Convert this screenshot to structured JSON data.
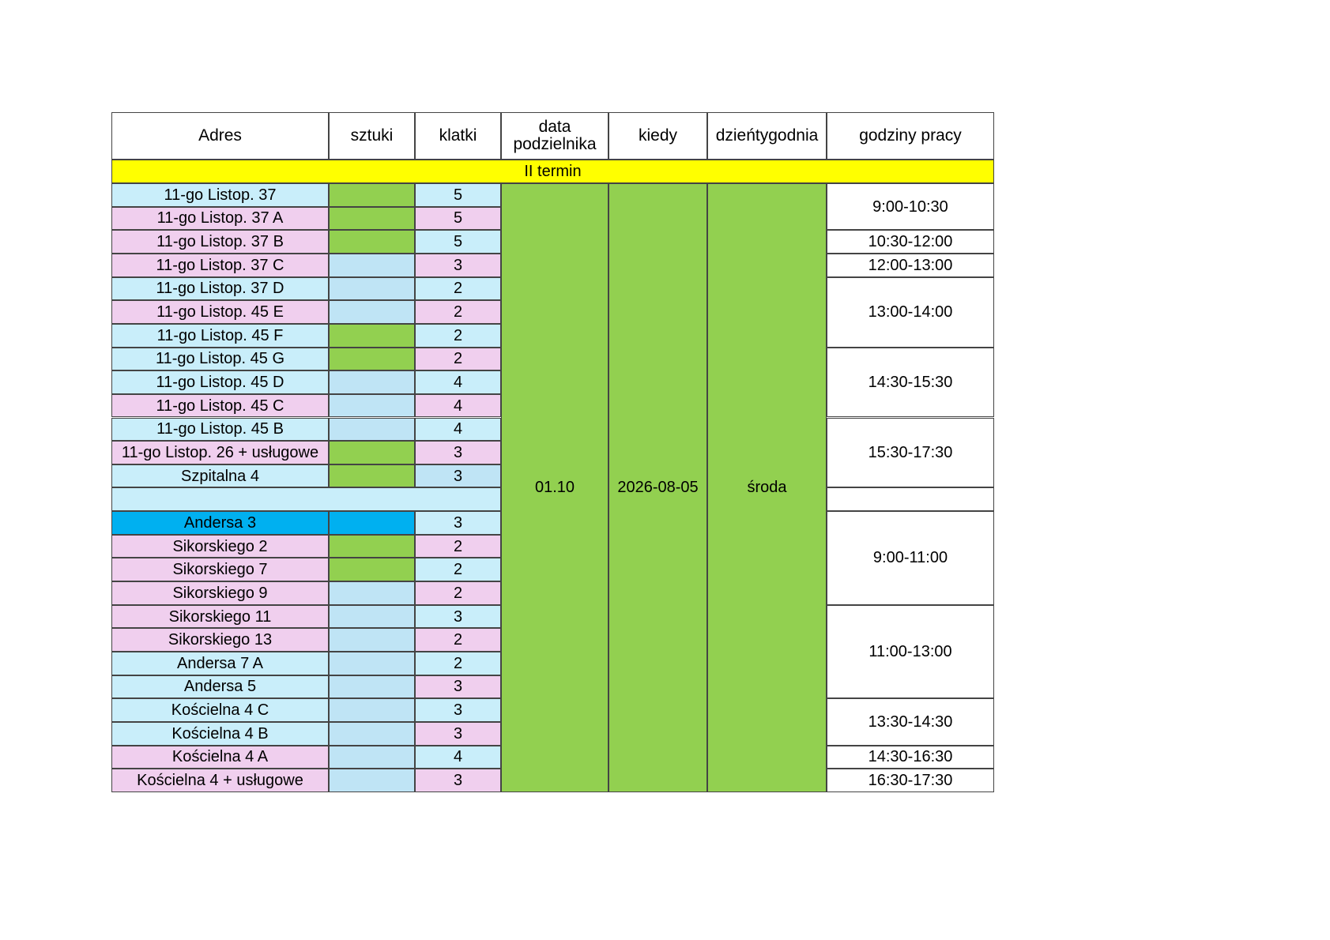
{
  "colors": {
    "header": "#ffffff",
    "section": "#ffff00",
    "light_blue": "#c9eefa",
    "pink": "#f0cfee",
    "green": "#92d050",
    "pale_blue": "#bfe4f5",
    "bright_blue": "#00b0f0",
    "white": "#ffffff"
  },
  "headers": [
    "Adres",
    "sztuki",
    "klatki",
    "data podzielnika",
    "kiedy",
    "dzieńtygodnia",
    "godziny pracy"
  ],
  "section": "II termin",
  "rows": [
    {
      "adres": "11-go Listop. 37",
      "klatki": "5",
      "adres_color": "light_blue",
      "sztuki_color": "green",
      "klatki_color": "light_blue"
    },
    {
      "adres": "11-go Listop. 37 A",
      "klatki": "5",
      "adres_color": "pink",
      "sztuki_color": "green",
      "klatki_color": "pink"
    },
    {
      "adres": "11-go Listop. 37 B",
      "klatki": "5",
      "adres_color": "pink",
      "sztuki_color": "green",
      "klatki_color": "light_blue"
    },
    {
      "adres": "11-go Listop. 37 C",
      "klatki": "3",
      "adres_color": "pink",
      "sztuki_color": "pale_blue",
      "klatki_color": "pink"
    },
    {
      "adres": "11-go Listop. 37 D",
      "klatki": "2",
      "adres_color": "light_blue",
      "sztuki_color": "pale_blue",
      "klatki_color": "light_blue"
    },
    {
      "adres": "11-go Listop. 45 E",
      "klatki": "2",
      "adres_color": "pink",
      "sztuki_color": "pale_blue",
      "klatki_color": "pink"
    },
    {
      "adres": "11-go Listop. 45 F",
      "klatki": "2",
      "adres_color": "light_blue",
      "sztuki_color": "green",
      "klatki_color": "light_blue"
    },
    {
      "adres": "11-go Listop. 45 G",
      "klatki": "2",
      "adres_color": "light_blue",
      "sztuki_color": "green",
      "klatki_color": "pink"
    },
    {
      "adres": "11-go Listop. 45 D",
      "klatki": "4",
      "adres_color": "light_blue",
      "sztuki_color": "pale_blue",
      "klatki_color": "light_blue"
    },
    {
      "adres": "11-go Listop. 45 C",
      "klatki": "4",
      "adres_color": "pink",
      "sztuki_color": "pale_blue",
      "klatki_color": "pink"
    },
    {
      "adres": "11-go Listop. 45 B",
      "klatki": "4",
      "adres_color": "light_blue",
      "sztuki_color": "pale_blue",
      "klatki_color": "light_blue"
    },
    {
      "adres": "11-go Listop. 26 + usługowe",
      "klatki": "3",
      "adres_color": "pink",
      "sztuki_color": "green",
      "klatki_color": "pink"
    },
    {
      "adres": "Szpitalna 4",
      "klatki": "3",
      "adres_color": "light_blue",
      "sztuki_color": "green",
      "klatki_color": "pale_blue"
    },
    {
      "adres": "",
      "klatki": "",
      "adres_color": "light_blue",
      "sztuki_color": "light_blue",
      "klatki_color": "light_blue",
      "merged": true
    },
    {
      "adres": "Andersa 3",
      "klatki": "3",
      "adres_color": "bright_blue",
      "sztuki_color": "bright_blue",
      "klatki_color": "light_blue"
    },
    {
      "adres": "Sikorskiego 2",
      "klatki": "2",
      "adres_color": "pink",
      "sztuki_color": "green",
      "klatki_color": "pink"
    },
    {
      "adres": "Sikorskiego 7",
      "klatki": "2",
      "adres_color": "pink",
      "sztuki_color": "green",
      "klatki_color": "light_blue"
    },
    {
      "adres": "Sikorskiego 9",
      "klatki": "2",
      "adres_color": "pink",
      "sztuki_color": "pale_blue",
      "klatki_color": "pink"
    },
    {
      "adres": "Sikorskiego 11",
      "klatki": "3",
      "adres_color": "pink",
      "sztuki_color": "pale_blue",
      "klatki_color": "light_blue"
    },
    {
      "adres": "Sikorskiego 13",
      "klatki": "2",
      "adres_color": "pink",
      "sztuki_color": "pale_blue",
      "klatki_color": "pink"
    },
    {
      "adres": "Andersa 7 A",
      "klatki": "2",
      "adres_color": "light_blue",
      "sztuki_color": "pale_blue",
      "klatki_color": "light_blue"
    },
    {
      "adres": "Andersa 5",
      "klatki": "3",
      "adres_color": "light_blue",
      "sztuki_color": "pale_blue",
      "klatki_color": "pink"
    },
    {
      "adres": "Kościelna 4 C",
      "klatki": "3",
      "adres_color": "light_blue",
      "sztuki_color": "pale_blue",
      "klatki_color": "light_blue"
    },
    {
      "adres": "Kościelna 4 B",
      "klatki": "3",
      "adres_color": "light_blue",
      "sztuki_color": "pale_blue",
      "klatki_color": "pink"
    },
    {
      "adres": "Kościelna 4 A",
      "klatki": "4",
      "adres_color": "pink",
      "sztuki_color": "pale_blue",
      "klatki_color": "light_blue"
    },
    {
      "adres": "Kościelna 4 + usługowe",
      "klatki": "3",
      "adres_color": "pink",
      "sztuki_color": "pale_blue",
      "klatki_color": "pink"
    }
  ],
  "merged": {
    "data_podzielnika": "01.10",
    "kiedy": "2026-08-05",
    "dzien": "środa"
  },
  "godziny": [
    {
      "text": "9:00-10:30",
      "rows": 2
    },
    {
      "text": "10:30-12:00",
      "rows": 1
    },
    {
      "text": "12:00-13:00",
      "rows": 1
    },
    {
      "text": "13:00-14:00",
      "rows": 3
    },
    {
      "text": "14:30-15:30",
      "rows": 3
    },
    {
      "text": "15:30-17:30",
      "rows": 3
    },
    {
      "text": "",
      "rows": 1
    },
    {
      "text": "9:00-11:00",
      "rows": 4
    },
    {
      "text": "11:00-13:00",
      "rows": 4
    },
    {
      "text": "13:30-14:30",
      "rows": 2
    },
    {
      "text": "14:30-16:30",
      "rows": 1
    },
    {
      "text": "16:30-17:30",
      "rows": 1
    }
  ]
}
